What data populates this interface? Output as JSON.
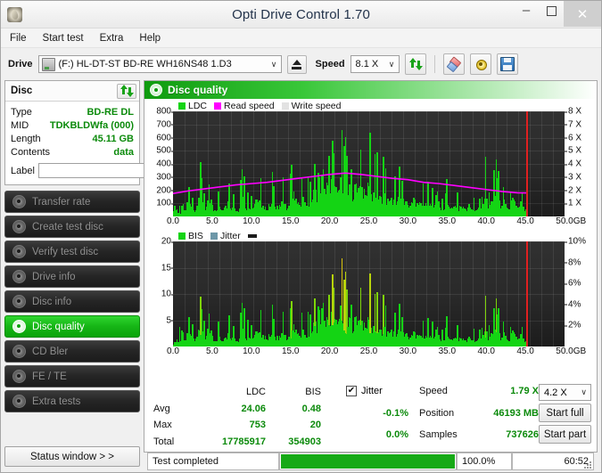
{
  "window": {
    "title": "Opti Drive Control 1.70",
    "app_icon": "disc-icon",
    "minimize": "–",
    "maximize": "□",
    "close": "✕"
  },
  "menu": [
    {
      "label": "File"
    },
    {
      "label": "Start test"
    },
    {
      "label": "Extra"
    },
    {
      "label": "Help"
    }
  ],
  "toolbar": {
    "drive_label": "Drive",
    "drive_value": "(F:)  HL-DT-ST BD-RE  WH16NS48 1.D3",
    "eject_title": "Eject",
    "speed_label": "Speed",
    "speed_value": "8.1 X",
    "caret": "∨",
    "icons": {
      "refresh": "refresh-icon",
      "eraser": "eraser-icon",
      "gear": "gear-icon",
      "save": "save-icon"
    }
  },
  "disc": {
    "title": "Disc",
    "rows": [
      {
        "key": "Type",
        "value": "BD-RE DL"
      },
      {
        "key": "MID",
        "value": "TDKBLDWfa (000)"
      },
      {
        "key": "Length",
        "value": "45.11 GB"
      },
      {
        "key": "Contents",
        "value": "data"
      }
    ],
    "label_key": "Label",
    "label_value": "",
    "label_placeholder": ""
  },
  "sidebar": {
    "items": [
      {
        "label": "Transfer rate",
        "active": false
      },
      {
        "label": "Create test disc",
        "active": false
      },
      {
        "label": "Verify test disc",
        "active": false
      },
      {
        "label": "Drive info",
        "active": false
      },
      {
        "label": "Disc info",
        "active": false
      },
      {
        "label": "Disc quality",
        "active": true
      },
      {
        "label": "CD Bler",
        "active": false
      },
      {
        "label": "FE / TE",
        "active": false
      },
      {
        "label": "Extra tests",
        "active": false
      }
    ],
    "status_window_button": "Status window > >"
  },
  "panel": {
    "title": "Disc quality"
  },
  "stats": {
    "col_headers": [
      "",
      "LDC",
      "BIS"
    ],
    "rows": [
      {
        "label": "Avg",
        "ldc": "24.06",
        "bis": "0.48",
        "jitter": "-0.1%"
      },
      {
        "label": "Max",
        "ldc": "753",
        "bis": "20",
        "jitter": "0.0%"
      },
      {
        "label": "Total",
        "ldc": "17785917",
        "bis": "354903",
        "jitter": ""
      }
    ],
    "jitter_label": "Jitter",
    "jitter_checked": true,
    "jitter_check_glyph": "✔",
    "right": [
      {
        "key": "Speed",
        "value": "1.79 X"
      },
      {
        "key": "Position",
        "value": "46193 MB"
      },
      {
        "key": "Samples",
        "value": "737626"
      }
    ],
    "speed_select": "4.2 X",
    "speed_caret": "∨",
    "start_full": "Start full",
    "start_part": "Start part"
  },
  "statusbar": {
    "status": "Test completed",
    "progress_percent": 100.0,
    "percent_text": "100.0%",
    "elapsed": "60:52"
  },
  "colors": {
    "ldc": "#14d414",
    "read_speed": "#ff00ff",
    "write_speed": "#e2e2e2",
    "bis": "#14d414",
    "jitter": "#6d97a8",
    "accent_green": "#0b8a0b",
    "marker_red": "#e02020",
    "plot_bg": "#262626"
  },
  "chart_data": [
    {
      "type": "bar",
      "id": "ldc-chart",
      "title": "Disc quality",
      "xlabel": "GB",
      "ylabel": "LDC",
      "xlim": [
        0,
        50
      ],
      "ylim": [
        0,
        800
      ],
      "y2lim": [
        0,
        8
      ],
      "y2label": "X",
      "xticks": [
        "0.0",
        "5.0",
        "10.0",
        "15.0",
        "20.0",
        "25.0",
        "30.0",
        "35.0",
        "40.0",
        "45.0",
        "50.0"
      ],
      "xtick_values": [
        0,
        5,
        10,
        15,
        20,
        25,
        30,
        35,
        40,
        45,
        50
      ],
      "yticks": [
        100,
        200,
        300,
        400,
        500,
        600,
        700,
        800
      ],
      "y2ticks": [
        1,
        2,
        3,
        4,
        5,
        6,
        7,
        8
      ],
      "x_unit": "GB",
      "grid": true,
      "legend_position": "top-left",
      "legend": [
        {
          "name": "LDC",
          "color": "#14d414"
        },
        {
          "name": "Read speed",
          "color": "#ff00ff"
        },
        {
          "name": "Write speed",
          "color": "#e2e2e2"
        }
      ],
      "data_end_gb": 45.11,
      "marker_line_gb": 45.11,
      "series": [
        {
          "name": "LDC",
          "type": "bar",
          "color": "#14d414",
          "x": [
            0.3,
            0.8,
            1.3,
            1.8,
            2.3,
            2.8,
            3.3,
            3.8,
            4.3,
            4.8,
            5.3,
            5.8,
            6.3,
            6.8,
            7.3,
            7.8,
            8.3,
            8.8,
            9.3,
            9.8,
            10.3,
            10.8,
            11.3,
            11.8,
            12.3,
            12.8,
            13.3,
            13.8,
            14.3,
            14.8,
            15.3,
            15.8,
            16.3,
            16.8,
            17.3,
            17.8,
            18.3,
            18.8,
            19.3,
            19.8,
            20.3,
            20.8,
            21.3,
            21.8,
            22.3,
            22.8,
            23.3,
            23.8,
            24.3,
            24.8,
            25.3,
            25.8,
            26.3,
            26.8,
            27.3,
            27.8,
            28.3,
            28.8,
            29.3,
            29.8,
            30.3,
            30.8,
            31.3,
            31.8,
            32.3,
            32.8,
            33.3,
            33.8,
            34.3,
            34.8,
            35.3,
            35.8,
            36.3,
            36.8,
            37.3,
            37.8,
            38.3,
            38.8,
            39.3,
            39.8,
            40.3,
            40.8,
            41.3,
            41.8,
            42.3,
            42.8,
            43.3,
            43.8,
            44.3,
            44.8
          ],
          "values": [
            180,
            95,
            150,
            380,
            210,
            120,
            545,
            260,
            175,
            330,
            190,
            240,
            140,
            310,
            200,
            265,
            150,
            480,
            220,
            175,
            300,
            410,
            230,
            190,
            280,
            350,
            195,
            420,
            240,
            310,
            500,
            280,
            360,
            450,
            330,
            540,
            600,
            470,
            700,
            620,
            760,
            680,
            753,
            710,
            650,
            590,
            700,
            640,
            560,
            680,
            610,
            520,
            470,
            560,
            430,
            500,
            380,
            460,
            350,
            420,
            300,
            390,
            270,
            360,
            250,
            330,
            230,
            310,
            210,
            290,
            195,
            280,
            180,
            260,
            170,
            250,
            165,
            240,
            155,
            470,
            230,
            340,
            520,
            300,
            420,
            260,
            380,
            230,
            340,
            200
          ]
        },
        {
          "name": "Read speed",
          "type": "line",
          "color": "#ff00ff",
          "unit": "X",
          "x": [
            0,
            2,
            4,
            6,
            8,
            10,
            12,
            14,
            16,
            18,
            20,
            21,
            22,
            23,
            24,
            26,
            28,
            30,
            32,
            34,
            36,
            38,
            40,
            42,
            44,
            45.11
          ],
          "values": [
            1.75,
            1.95,
            2.1,
            2.25,
            2.4,
            2.5,
            2.6,
            2.75,
            2.9,
            3.05,
            3.2,
            3.25,
            3.3,
            3.25,
            3.2,
            3.05,
            2.9,
            2.8,
            2.6,
            2.5,
            2.35,
            2.2,
            2.05,
            1.9,
            1.8,
            1.79
          ]
        }
      ]
    },
    {
      "type": "bar",
      "id": "bis-chart",
      "xlabel": "GB",
      "ylabel": "BIS",
      "xlim": [
        0,
        50
      ],
      "ylim": [
        0,
        20
      ],
      "y2lim": [
        0,
        10
      ],
      "y2label": "%",
      "xticks": [
        "0.0",
        "5.0",
        "10.0",
        "15.0",
        "20.0",
        "25.0",
        "30.0",
        "35.0",
        "40.0",
        "45.0",
        "50.0"
      ],
      "xtick_values": [
        0,
        5,
        10,
        15,
        20,
        25,
        30,
        35,
        40,
        45,
        50
      ],
      "yticks": [
        5,
        10,
        15,
        20
      ],
      "y2ticks": [
        2,
        4,
        6,
        8,
        10
      ],
      "x_unit": "GB",
      "grid": true,
      "legend_position": "top-left",
      "legend": [
        {
          "name": "BIS",
          "color": "#14d414"
        },
        {
          "name": "Jitter",
          "color": "#6d97a8"
        }
      ],
      "data_end_gb": 45.11,
      "marker_line_gb": 45.11,
      "series": [
        {
          "name": "BIS",
          "type": "bar",
          "color": "#14d414",
          "x": [
            0.3,
            0.8,
            1.3,
            1.8,
            2.3,
            2.8,
            3.3,
            3.8,
            4.3,
            4.8,
            5.3,
            5.8,
            6.3,
            6.8,
            7.3,
            7.8,
            8.3,
            8.8,
            9.3,
            9.8,
            10.3,
            10.8,
            11.3,
            11.8,
            12.3,
            12.8,
            13.3,
            13.8,
            14.3,
            14.8,
            15.3,
            15.8,
            16.3,
            16.8,
            17.3,
            17.8,
            18.3,
            18.8,
            19.3,
            19.8,
            20.3,
            20.8,
            21.3,
            21.8,
            22.3,
            22.8,
            23.3,
            23.8,
            24.3,
            24.8,
            25.3,
            25.8,
            26.3,
            26.8,
            27.3,
            27.8,
            28.3,
            28.8,
            29.3,
            29.8,
            30.3,
            30.8,
            31.3,
            31.8,
            32.3,
            32.8,
            33.3,
            33.8,
            34.3,
            34.8,
            35.3,
            35.8,
            36.3,
            36.8,
            37.3,
            37.8,
            38.3,
            38.8,
            39.3,
            39.8,
            40.3,
            40.8,
            41.3,
            41.8,
            42.3,
            42.8,
            43.3,
            43.8,
            44.3,
            44.8
          ],
          "values": [
            3,
            5,
            4,
            9,
            6,
            4,
            12,
            7,
            5,
            8,
            4,
            6,
            3,
            7,
            5,
            6,
            4,
            11,
            6,
            5,
            7,
            9,
            6,
            5,
            7,
            8,
            5,
            9,
            6,
            7,
            11,
            7,
            8,
            9,
            8,
            12,
            14,
            11,
            16,
            13,
            18,
            15,
            20,
            17,
            15,
            13,
            16,
            14,
            12,
            15,
            13,
            11,
            10,
            12,
            9,
            11,
            8,
            10,
            7,
            9,
            6,
            8,
            6,
            7,
            5,
            7,
            5,
            6,
            5,
            6,
            4,
            6,
            4,
            5,
            4,
            5,
            4,
            5,
            4,
            10,
            5,
            7,
            11,
            6,
            9,
            5,
            8,
            5,
            7,
            4
          ]
        }
      ]
    }
  ]
}
